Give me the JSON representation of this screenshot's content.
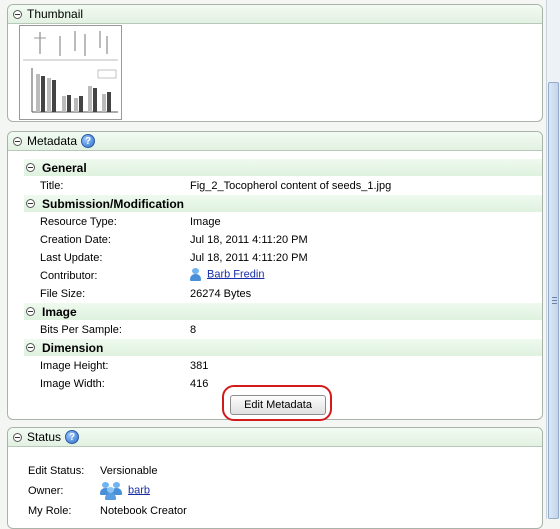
{
  "thumbnail": {
    "title": "Thumbnail"
  },
  "metadata": {
    "title": "Metadata",
    "help_glyph": "?",
    "general": {
      "heading": "General",
      "title_label": "Title:",
      "title_value": "Fig_2_Tocopherol content of seeds_1.jpg"
    },
    "submission": {
      "heading": "Submission/Modification",
      "rows": [
        {
          "label": "Resource Type:",
          "value": "Image"
        },
        {
          "label": "Creation Date:",
          "value": "Jul 18, 2011 4:11:20 PM"
        },
        {
          "label": "Last Update:",
          "value": "Jul 18, 2011 4:11:20 PM"
        },
        {
          "label": "Contributor:",
          "value": "Barb Fredin"
        },
        {
          "label": "File Size:",
          "value": "26274 Bytes"
        }
      ]
    },
    "image": {
      "heading": "Image",
      "bits_label": "Bits Per Sample:",
      "bits_value": "8"
    },
    "dimension": {
      "heading": "Dimension",
      "height_label": "Image Height:",
      "height_value": "381",
      "width_label": "Image Width:",
      "width_value": "416"
    },
    "edit_button": "Edit Metadata"
  },
  "status": {
    "title": "Status",
    "help_glyph": "?",
    "rows": [
      {
        "label": "Edit Status:",
        "value": "Versionable"
      },
      {
        "label": "Owner:",
        "value": "barb"
      },
      {
        "label": "My Role:",
        "value": "Notebook Creator"
      }
    ]
  },
  "colors": {
    "panel_header": "#e2f1e2",
    "section_header": "#dff1df",
    "link": "#1a2fa8",
    "highlight": "#d21a1a"
  },
  "icons": [
    "collapse-icon",
    "help-icon",
    "user-icon",
    "group-icon"
  ]
}
